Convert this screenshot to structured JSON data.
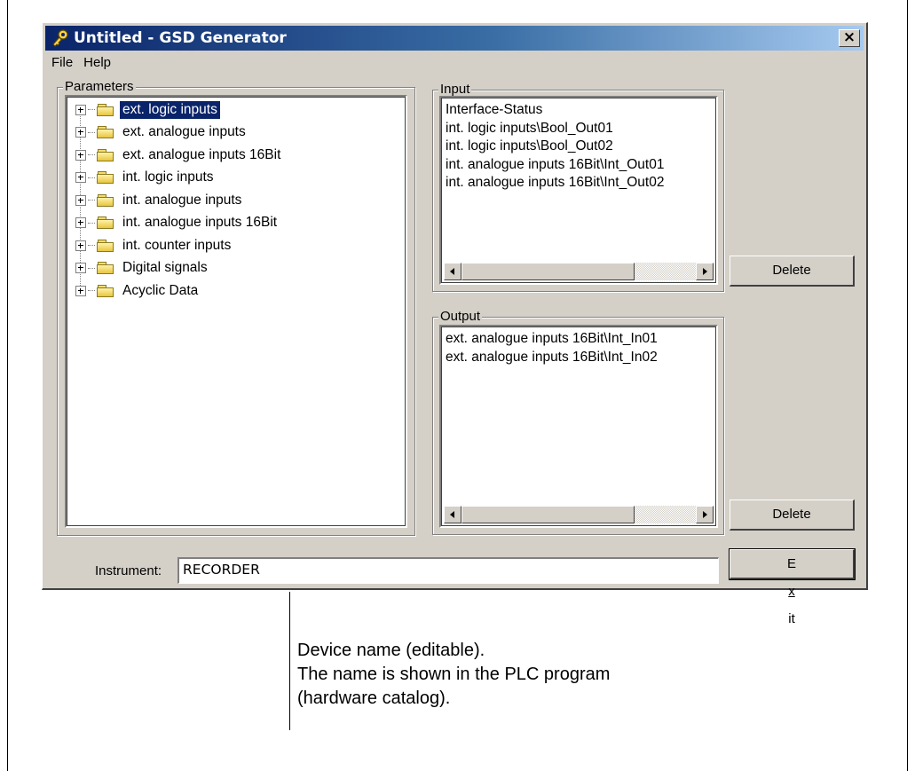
{
  "window": {
    "title": "Untitled - GSD Generator",
    "close_label": "×"
  },
  "menu": [
    "File",
    "Help"
  ],
  "parameters": {
    "label": "Parameters",
    "items": [
      "ext. logic inputs",
      "ext. analogue inputs",
      "ext. analogue inputs 16Bit",
      "int. logic inputs",
      "int. analogue inputs",
      "int. analogue inputs 16Bit",
      "int. counter inputs",
      "Digital signals",
      "Acyclic Data"
    ],
    "selected_index": 0
  },
  "input": {
    "label": "Input",
    "items": [
      "Interface-Status",
      "int. logic inputs\\Bool_Out01",
      "int. logic inputs\\Bool_Out02",
      "int. analogue inputs 16Bit\\Int_Out01",
      "int. analogue inputs 16Bit\\Int_Out02"
    ],
    "delete_label": "Delete"
  },
  "output": {
    "label": "Output",
    "items": [
      "ext. analogue inputs 16Bit\\Int_In01",
      "ext. analogue inputs 16Bit\\Int_In02"
    ],
    "delete_label": "Delete"
  },
  "instrument": {
    "label": "Instrument:",
    "value": "RECORDER"
  },
  "exit": {
    "before": "E",
    "accel": "x",
    "after": "it"
  },
  "annotation": {
    "line1": "Device name (editable).",
    "line2": "The name is shown in the PLC program",
    "line3": "(hardware catalog)."
  },
  "colors": {
    "titlebar_start": "#0a246a",
    "titlebar_end": "#a6caf0",
    "face": "#d4d0c8",
    "selection": "#0a246a"
  },
  "icons": [
    "key-icon",
    "close-icon",
    "folder-icon",
    "expand-plus-icon",
    "scroll-left-arrow-icon",
    "scroll-right-arrow-icon"
  ]
}
